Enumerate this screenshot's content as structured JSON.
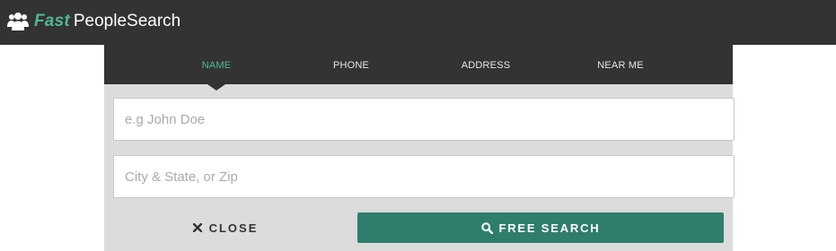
{
  "header": {
    "logo_fast": "Fast",
    "logo_rest": "PeopleSearch",
    "logo_icon": "people-group-icon"
  },
  "tabs": [
    {
      "label": "NAME",
      "active": true
    },
    {
      "label": "PHONE",
      "active": false
    },
    {
      "label": "ADDRESS",
      "active": false
    },
    {
      "label": "NEAR ME",
      "active": false
    }
  ],
  "form": {
    "name_placeholder": "e.g John Doe",
    "name_value": "",
    "location_placeholder": "City & State, or Zip",
    "location_value": "",
    "close_label": "CLOSE",
    "close_icon": "close-x-icon",
    "search_label": "FREE SEARCH",
    "search_icon": "magnifier-icon"
  },
  "colors": {
    "topbar": "#333333",
    "brand_green": "#4db891",
    "button_green": "#2f7d6d",
    "panel_bg": "#dcdcdc"
  }
}
